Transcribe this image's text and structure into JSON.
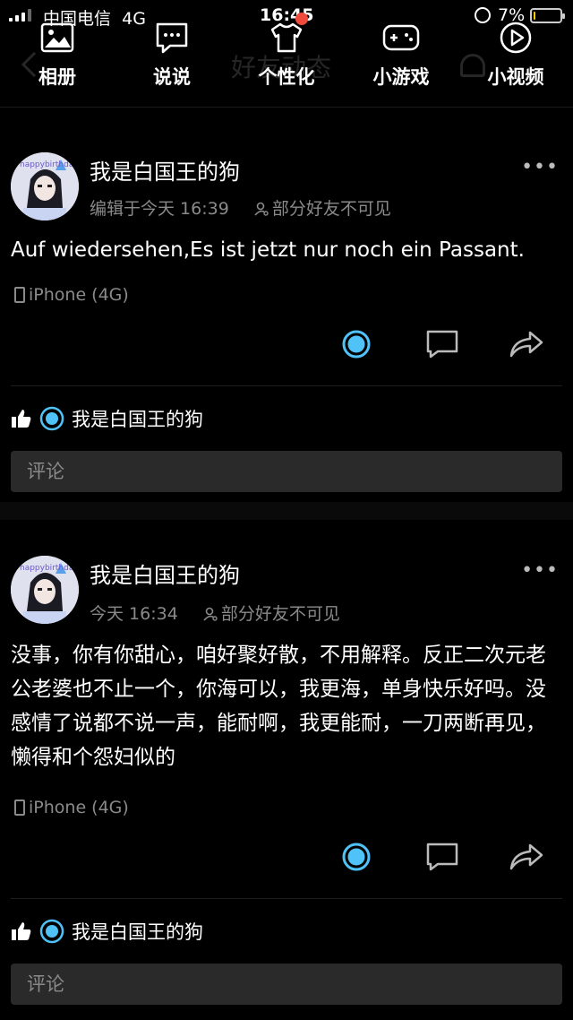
{
  "status_bar": {
    "carrier": "中国电信",
    "network": "4G",
    "time": "16:45",
    "battery": "7%",
    "battery_level": 0.07,
    "battery_color": "#ffcc00"
  },
  "header": {
    "title": "好友动态"
  },
  "quick_nav": [
    {
      "label": "相册",
      "icon": "photo-album-icon"
    },
    {
      "label": "说说",
      "icon": "speech-bubble-icon"
    },
    {
      "label": "个性化",
      "icon": "tshirt-icon"
    },
    {
      "label": "小游戏",
      "icon": "gamepad-icon"
    },
    {
      "label": "小视频",
      "icon": "play-circle-icon"
    }
  ],
  "posts": [
    {
      "author": "我是白国王的狗",
      "avatar_text": "happybirthday",
      "time": "编辑于今天 16:39",
      "privacy": "部分好友不可见",
      "text": "Auf wiedersehen,Es ist jetzt nur noch ein Passant.",
      "device": "iPhone (4G)",
      "likers": "我是白国王的狗",
      "comment_placeholder": "评论"
    },
    {
      "author": "我是白国王的狗",
      "avatar_text": "happybirthday",
      "time": "今天 16:34",
      "privacy": "部分好友不可见",
      "text": "没事，你有你甜心，咱好聚好散，不用解释。反正二次元老公老婆也不止一个，你海可以，我更海，单身快乐好吗。没感情了说都不说一声，能耐啊，我更能耐，一刀两断再见，懒得和个怨妇似的",
      "device": "iPhone (4G)",
      "likers": "我是白国王的狗",
      "comment_placeholder": "评论"
    }
  ],
  "colors": {
    "accent": "#38b6f0",
    "like_icon": "#4fc3f7",
    "background": "#000000",
    "secondary_text": "#8a8a8a",
    "comment_bg": "#2a2a2a",
    "badge": "#f04a3d"
  }
}
